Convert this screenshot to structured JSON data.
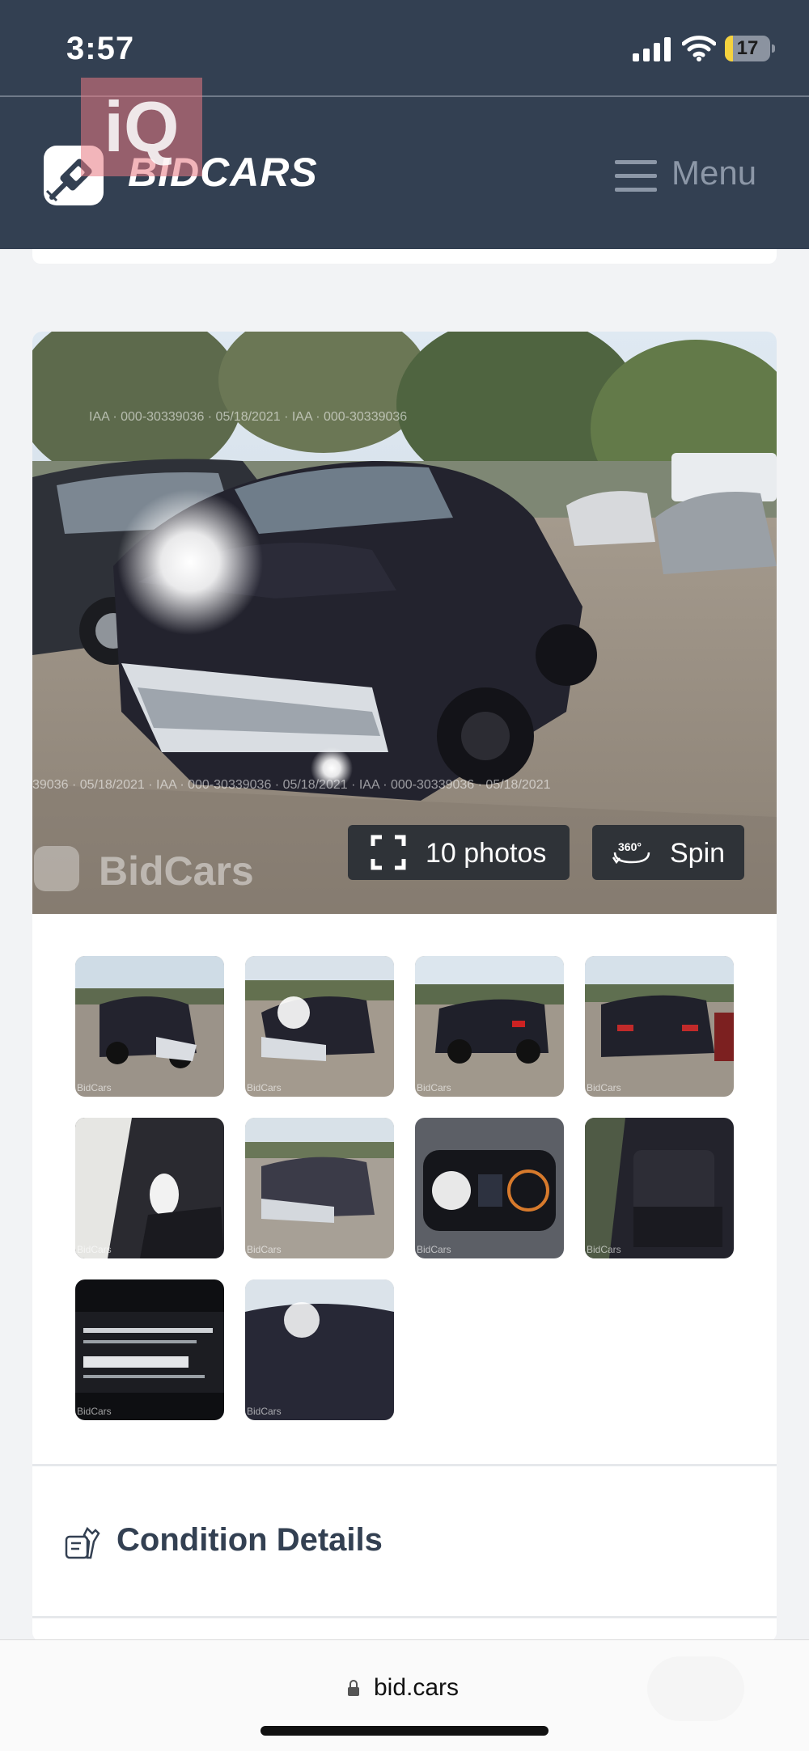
{
  "status_bar": {
    "time": "3:57",
    "battery_level": "17",
    "battery_fraction": 0.17
  },
  "header": {
    "brand": "BIDCARS",
    "menu_label": "Menu",
    "overlay_badge": "iQ"
  },
  "gallery": {
    "photos_button_label": "10 photos",
    "spin_button_label": "Spin",
    "spin_icon_text": "360°",
    "watermark_text": "BidCars",
    "thumbnail_count": 10,
    "thumbnail_watermark": "BidCars"
  },
  "sections": {
    "condition_details_title": "Condition Details"
  },
  "browser": {
    "url": "bid.cars"
  },
  "colors": {
    "header_bg": "#334052",
    "accent_text": "#334052",
    "button_bg": "#2f3338",
    "battery_fill": "#f5d23e"
  },
  "icons": [
    "signal-icon",
    "wifi-icon",
    "battery-icon",
    "bidcars-logo-icon",
    "hamburger-menu-icon",
    "fullscreen-icon",
    "spin-360-icon",
    "condition-details-icon",
    "lock-icon"
  ]
}
